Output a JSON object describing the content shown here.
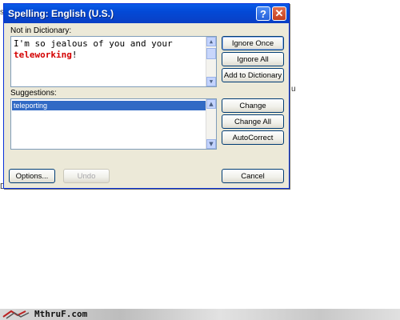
{
  "dialog": {
    "title": "Spelling: English (U.S.)",
    "help_label": "?",
    "close_label": "✕",
    "not_in_dictionary_label": "Not in Dictionary:",
    "sentence_before": "I'm so jealous of you and your",
    "flagged_word": "teleworking",
    "sentence_after": "!",
    "suggestions_label": "Suggestions:",
    "suggestions": [
      "teleporting"
    ],
    "buttons": {
      "ignore_once": "Ignore Once",
      "ignore_all": "Ignore All",
      "add_to_dictionary": "Add to Dictionary",
      "change": "Change",
      "change_all": "Change All",
      "autocorrect": "AutoCorrect",
      "options": "Options...",
      "undo": "Undo",
      "cancel": "Cancel"
    }
  },
  "watermark": {
    "site": "MthruF.com"
  },
  "colors": {
    "title_bar": "#0a5ce8",
    "flagged_text": "#d40000",
    "selection": "#316ac5",
    "dialog_bg": "#ece9d8"
  }
}
